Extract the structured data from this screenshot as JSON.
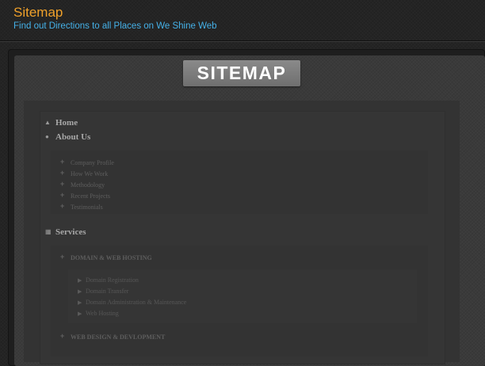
{
  "header": {
    "title": "Sitemap",
    "subtitle": "Find out Directions to all Places on We Shine Web"
  },
  "banner": {
    "text": "SITEMAP"
  },
  "sitemap": {
    "home": {
      "label": "Home",
      "icon": "home-icon"
    },
    "about": {
      "label": "About Us",
      "icon": "user-icon",
      "children": [
        "Company Profile",
        "How We Work",
        "Methodology",
        "Recent Projects",
        "Testimonials"
      ]
    },
    "services": {
      "label": "Services",
      "icon": "grid-icon",
      "domain": {
        "label": "DOMAIN & WEB HOSTING",
        "children": [
          "Domain Registration",
          "Domain Transfer",
          "Domain Administration & Maintenance",
          "Web Hosting"
        ]
      },
      "webdesign": {
        "label": "WEB DESIGN & DEVLOPMENT"
      }
    }
  },
  "colors": {
    "title": "#f0a12a",
    "subtitle": "#45b1e8",
    "background": "#242424"
  }
}
